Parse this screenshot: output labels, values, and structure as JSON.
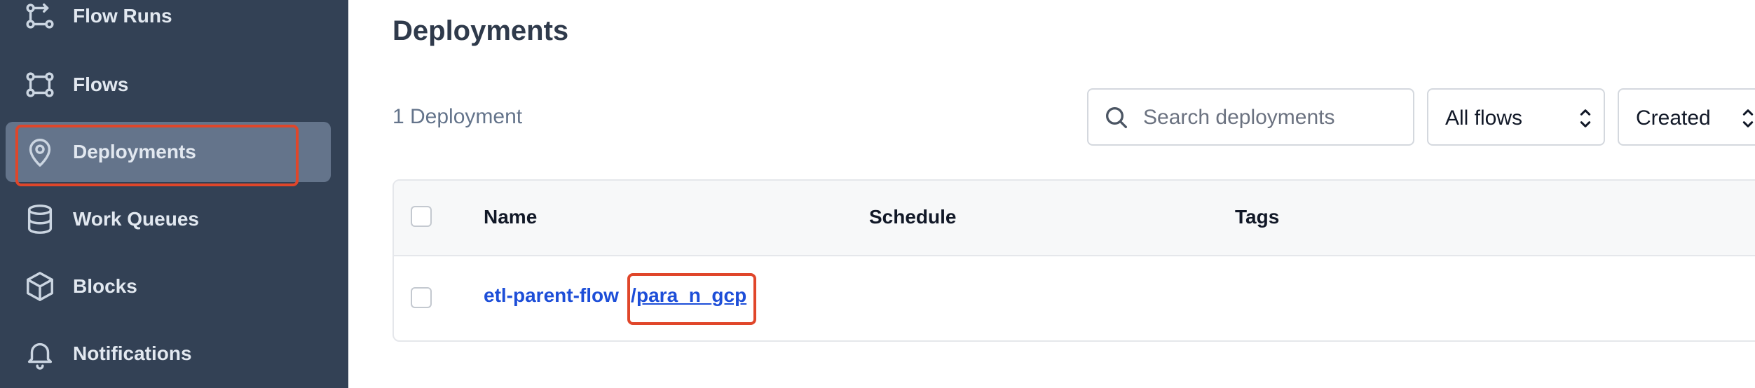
{
  "sidebar": {
    "items": [
      {
        "label": "Flow Runs",
        "icon": "flow-runs-icon"
      },
      {
        "label": "Flows",
        "icon": "flows-icon"
      },
      {
        "label": "Deployments",
        "icon": "location-pin-icon",
        "active": true
      },
      {
        "label": "Work Queues",
        "icon": "database-icon"
      },
      {
        "label": "Blocks",
        "icon": "cube-icon"
      },
      {
        "label": "Notifications",
        "icon": "bell-icon"
      }
    ]
  },
  "main": {
    "title": "Deployments",
    "count_label": "1 Deployment",
    "search": {
      "placeholder": "Search deployments",
      "value": ""
    },
    "flow_filter": {
      "selected": "All flows"
    },
    "sort_select": {
      "selected": "Created"
    },
    "table": {
      "headers": [
        "Name",
        "Schedule",
        "Tags"
      ],
      "rows": [
        {
          "flow": "etl-parent-flow",
          "separator": "/",
          "deployment": "para_n_gcp",
          "schedule": "",
          "tags": ""
        }
      ]
    }
  },
  "colors": {
    "sidebar_bg": "#334155",
    "active_item_bg": "#64748b",
    "link": "#1d4ed8",
    "highlight": "#e0462a"
  }
}
